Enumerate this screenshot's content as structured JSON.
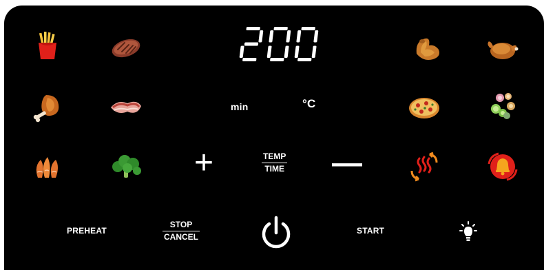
{
  "display": {
    "temperature": "200"
  },
  "units": {
    "time": "min",
    "temp": "°C"
  },
  "controls": {
    "plus_symbol": "+",
    "minus_symbol": "—",
    "temp_label": "TEMP",
    "time_label": "TIME",
    "preheat_label": "PREHEAT",
    "stop_label": "STOP",
    "cancel_label": "CANCEL",
    "start_label": "START"
  },
  "presets": [
    {
      "name": "fries",
      "icon": "fries-icon"
    },
    {
      "name": "steak",
      "icon": "steak-icon"
    },
    {
      "name": "chicken wings",
      "icon": "chicken-wing-icon"
    },
    {
      "name": "whole chicken",
      "icon": "roast-chicken-icon"
    },
    {
      "name": "drumstick",
      "icon": "drumstick-icon"
    },
    {
      "name": "bacon",
      "icon": "bacon-icon"
    },
    {
      "name": "pizza",
      "icon": "pizza-icon"
    },
    {
      "name": "vegetables",
      "icon": "vegetables-icon"
    },
    {
      "name": "shrimp",
      "icon": "shrimp-icon"
    },
    {
      "name": "broccoli",
      "icon": "broccoli-icon"
    },
    {
      "name": "heat",
      "icon": "heat-waves-icon"
    },
    {
      "name": "shake reminder",
      "icon": "shake-reminder-icon"
    }
  ],
  "extras": {
    "power_icon": "power-icon",
    "light_icon": "light-bulb-icon"
  },
  "colors": {
    "panel": "#000000",
    "text": "#ffffff",
    "accent_red": "#e0201a",
    "accent_orange": "#f08a1e"
  }
}
